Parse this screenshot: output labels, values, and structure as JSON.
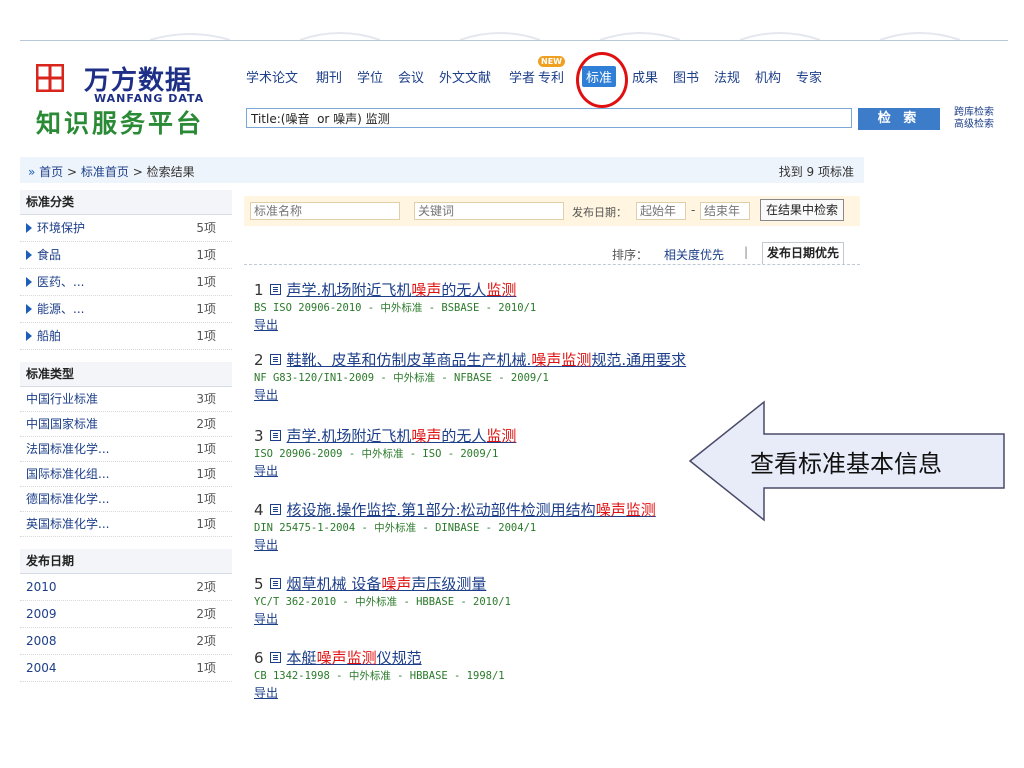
{
  "logo": {
    "brand_cn": "万方数据",
    "brand_en": "WANFANG DATA",
    "tagline": "知识服务平台"
  },
  "nav": {
    "items": [
      {
        "label": "学术论文"
      },
      {
        "label": "期刊"
      },
      {
        "label": "学位"
      },
      {
        "label": "会议"
      },
      {
        "label": "外文文献"
      },
      {
        "label": "学者"
      },
      {
        "label": "专利"
      },
      {
        "label": "标准"
      },
      {
        "label": "成果"
      },
      {
        "label": "图书"
      },
      {
        "label": "法规"
      },
      {
        "label": "机构"
      },
      {
        "label": "专家"
      }
    ],
    "active_index": 7,
    "new_badge": "NEW"
  },
  "search": {
    "value": "Title:(噪音  or 噪声) 监测",
    "button_label": "检 索",
    "link_cross": "跨库检索",
    "link_advanced": "高级检索"
  },
  "breadcrumb": {
    "prefix": "»",
    "home": "首页",
    "section": "标准首页",
    "current": "检索结果",
    "sep": ">",
    "found": "找到 9 项标准"
  },
  "sidebar": {
    "category_title": "标准分类",
    "categories": [
      {
        "label": "环境保护",
        "count": "5项"
      },
      {
        "label": "食品",
        "count": "1项"
      },
      {
        "label": "医药、...",
        "count": "1项"
      },
      {
        "label": "能源、...",
        "count": "1项"
      },
      {
        "label": "船舶",
        "count": "1项"
      }
    ],
    "type_title": "标准类型",
    "types": [
      {
        "label": "中国行业标准",
        "count": "3项"
      },
      {
        "label": "中国国家标准",
        "count": "2项"
      },
      {
        "label": "法国标准化学...",
        "count": "1项"
      },
      {
        "label": "国际标准化组...",
        "count": "1项"
      },
      {
        "label": "德国标准化学...",
        "count": "1项"
      },
      {
        "label": "英国标准化学...",
        "count": "1项"
      }
    ],
    "date_title": "发布日期",
    "dates": [
      {
        "label": "2010",
        "count": "2项"
      },
      {
        "label": "2009",
        "count": "2项"
      },
      {
        "label": "2008",
        "count": "2项"
      },
      {
        "label": "2004",
        "count": "1项"
      }
    ]
  },
  "filter": {
    "name_placeholder": "标准名称",
    "keyword_placeholder": "关键词",
    "date_label": "发布日期：",
    "start_placeholder": "起始年",
    "dash": "-",
    "end_placeholder": "结束年",
    "button_label": "在结果中检索"
  },
  "sort": {
    "label": "排序：",
    "relevance": "相关度优先",
    "sep": "|",
    "date": "发布日期优先"
  },
  "results": [
    {
      "num": "1",
      "pre": "声学.机场附近飞机",
      "hl1": "噪声",
      "mid": "的无人",
      "hl2": "监测",
      "post": "",
      "meta": "BS ISO 20906-2010 - 中外标准 - BSBASE - 2010/1",
      "export": "导出"
    },
    {
      "num": "2",
      "pre": "鞋靴、皮革和仿制皮革商品生产机械.",
      "hl1": "噪声",
      "mid": "",
      "hl2": "监测",
      "post": "规范.通用要求",
      "meta": "NF G83-120/IN1-2009 - 中外标准 - NFBASE - 2009/1",
      "export": "导出"
    },
    {
      "num": "3",
      "pre": "声学.机场附近飞机",
      "hl1": "噪声",
      "mid": "的无人",
      "hl2": "监测",
      "post": "",
      "meta": "ISO 20906-2009 - 中外标准 - ISO - 2009/1",
      "export": "导出"
    },
    {
      "num": "4",
      "pre": "核设施.操作监控.第1部分:松动部件检测用结构",
      "hl1": "噪声",
      "mid": "",
      "hl2": "监测",
      "post": "",
      "meta": "DIN 25475-1-2004 - 中外标准 - DINBASE - 2004/1",
      "export": "导出"
    },
    {
      "num": "5",
      "pre": "烟草机械 设备",
      "hl1": "噪声",
      "mid": "",
      "hl2": "",
      "post": "声压级测量",
      "meta": "YC/T 362-2010 - 中外标准 - HBBASE - 2010/1",
      "export": "导出"
    },
    {
      "num": "6",
      "pre": "本艇",
      "hl1": "噪声",
      "mid": "",
      "hl2": "监测",
      "post": "仪规范",
      "meta": "CB 1342-1998 - 中外标准 - HBBASE - 1998/1",
      "export": "导出"
    }
  ],
  "callout": {
    "text": "查看标准基本信息"
  },
  "colors": {
    "brand_blue": "#1d2f86",
    "brand_green": "#2a8a35",
    "logo_red": "#d8261d",
    "link": "#1d3f8a",
    "highlight": "#e01010",
    "meta_green": "#2a7a2a",
    "nav_active": "#2f7fd6",
    "search_button": "#3d7cc9",
    "callout_fill": "#e8ecf8"
  }
}
